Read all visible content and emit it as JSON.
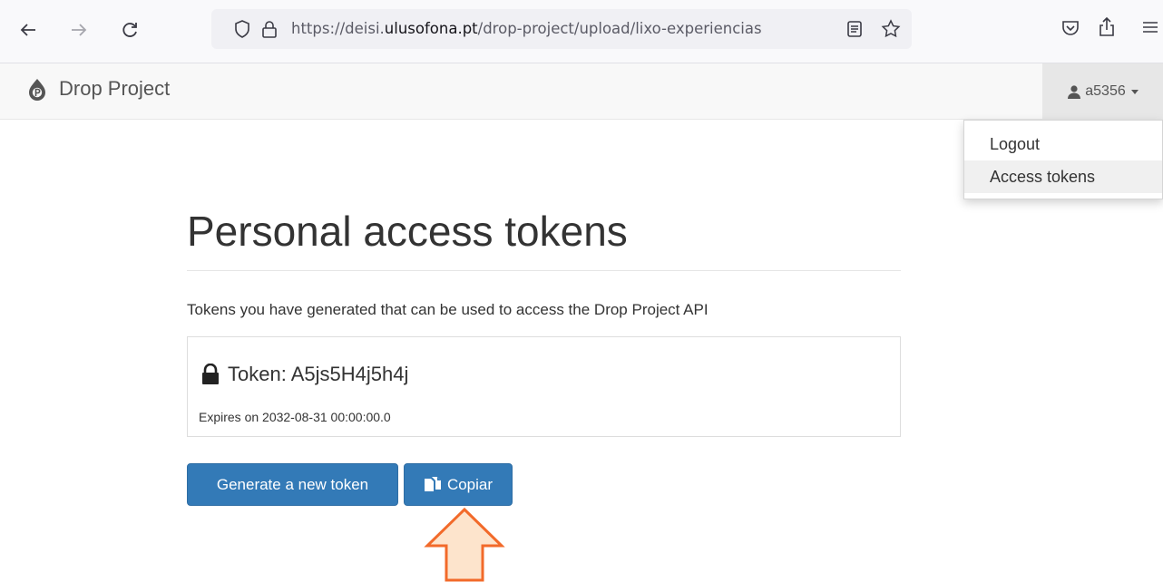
{
  "browser": {
    "url_prefix": "https://deisi.",
    "url_host": "ulusofona.pt",
    "url_path": "/drop-project/upload/lixo-experiencias"
  },
  "navbar": {
    "brand": "Drop Project",
    "user": "a5356"
  },
  "dropdown": {
    "items": [
      {
        "label": "Logout"
      },
      {
        "label": "Access tokens"
      }
    ]
  },
  "main": {
    "title": "Personal access tokens",
    "intro": "Tokens you have generated that can be used to access the Drop Project API",
    "token": {
      "label": "Token: A5js5H4j5h4j",
      "expires": "Expires on 2032-08-31 00:00:00.0"
    },
    "buttons": {
      "generate": "Generate a new token",
      "copy": "Copiar"
    }
  },
  "colors": {
    "primary": "#337ab7",
    "arrow_fill": "#fde4cc",
    "arrow_stroke": "#f26a2a"
  },
  "icons": [
    "back-icon",
    "forward-icon",
    "reload-icon",
    "shield-icon",
    "lock-icon",
    "reader-icon",
    "star-icon",
    "pocket-icon",
    "share-icon",
    "menu-icon",
    "drop-logo-icon",
    "user-icon",
    "copy-icon",
    "arrow-up-icon"
  ]
}
